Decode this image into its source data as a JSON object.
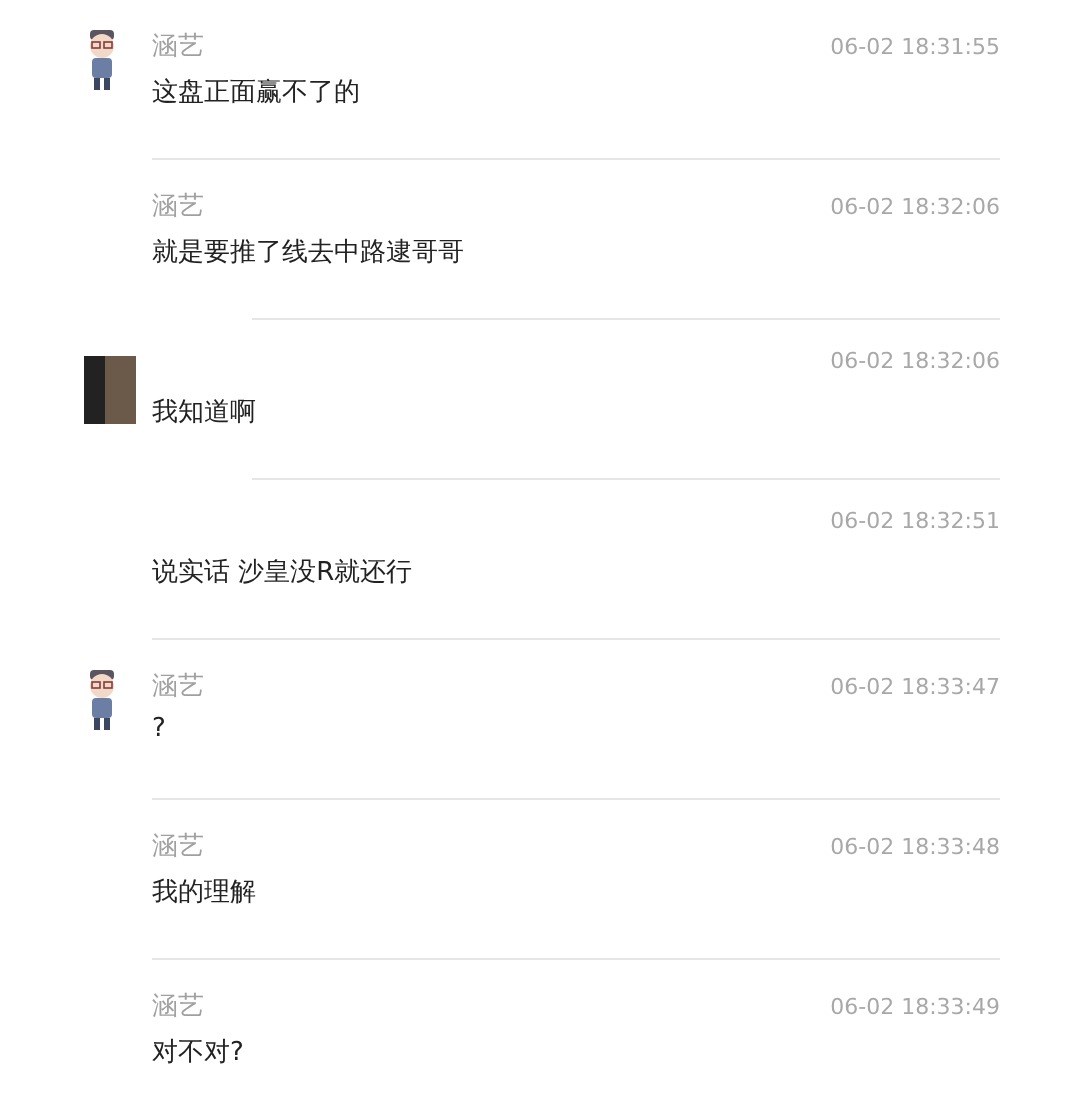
{
  "messages": [
    {
      "avatar": {
        "kind": "cartoon"
      },
      "name": "涵艺",
      "time": "06-02 18:31:55",
      "text": "这盘正面赢不了的",
      "divider": {
        "kind": "full"
      }
    },
    {
      "name": "涵艺",
      "time": "06-02 18:32:06",
      "text": "就是要推了线去中路逮哥哥",
      "divider": {
        "kind": "short"
      }
    },
    {
      "avatar": {
        "kind": "pixel"
      },
      "time": "06-02 18:32:06",
      "text": "我知道啊",
      "divider": {
        "kind": "short"
      }
    },
    {
      "time": "06-02 18:32:51",
      "text": "说实话  沙皇没R就还行",
      "divider": {
        "kind": "full"
      }
    },
    {
      "avatar": {
        "kind": "cartoon"
      },
      "name": "涵艺",
      "time": "06-02 18:33:47",
      "text": "?",
      "divider": {
        "kind": "full"
      }
    },
    {
      "name": "涵艺",
      "time": "06-02 18:33:48",
      "text": "我的理解",
      "divider": {
        "kind": "full"
      }
    },
    {
      "name": "涵艺",
      "time": "06-02 18:33:49",
      "text": "对不对?"
    }
  ]
}
